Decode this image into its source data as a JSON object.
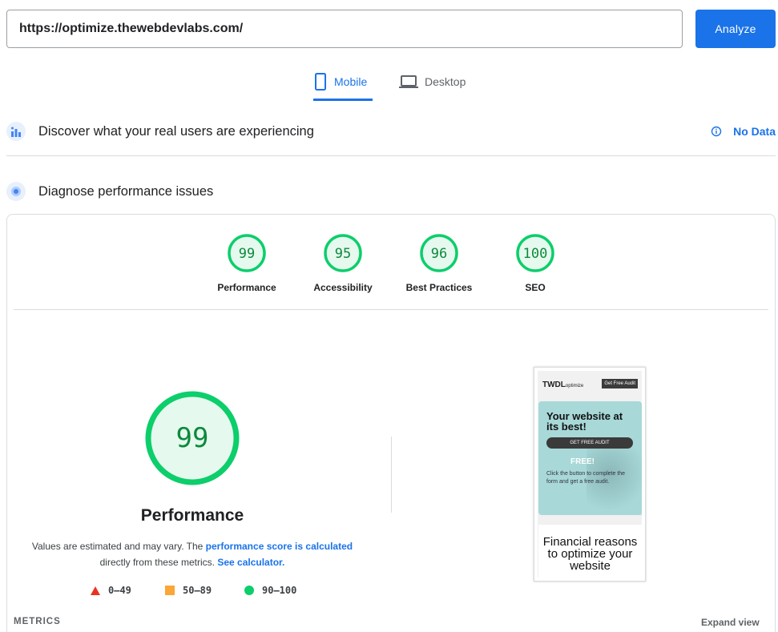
{
  "search": {
    "url_value": "https://optimize.thewebdevlabs.com/",
    "analyze_label": "Analyze"
  },
  "tabs": [
    {
      "label": "Mobile",
      "icon": "smartphone-icon",
      "active": true
    },
    {
      "label": "Desktop",
      "icon": "laptop-icon",
      "active": false
    }
  ],
  "crux": {
    "title": "Discover what your real users are experiencing",
    "icon": "users-chart-icon",
    "status_icon": "info-icon",
    "status": "No Data"
  },
  "diagnose": {
    "title": "Diagnose performance issues",
    "icon": "lighthouse-icon"
  },
  "categories": [
    {
      "score": 99,
      "label": "Performance"
    },
    {
      "score": 95,
      "label": "Accessibility"
    },
    {
      "score": 96,
      "label": "Best Practices"
    },
    {
      "score": 100,
      "label": "SEO"
    }
  ],
  "performance": {
    "score": 99,
    "title": "Performance",
    "desc_prefix": "Values are estimated and may vary. The ",
    "desc_link": "performance score is calculated",
    "desc_middle": "directly from these metrics. ",
    "desc_link2": "See calculator.",
    "legend": [
      {
        "range": "0–49",
        "shape": "triangle",
        "color": "#e8341f"
      },
      {
        "range": "50–89",
        "shape": "square",
        "color": "#fba637"
      },
      {
        "range": "90–100",
        "shape": "circle",
        "color": "#0cce6b"
      }
    ]
  },
  "thumbnail": {
    "brand": "TWDL",
    "brand_small": "optimize",
    "audit_btn": "Get Free Audit",
    "hero_title": "Your website at its best!",
    "hero_btn": "GET FREE AUDIT",
    "free": "FREE!",
    "body": "Click the button to complete the form and get a free audit.",
    "bottom_title": "Financial reasons to optimize your website"
  },
  "metrics": {
    "label": "METRICS",
    "expand": "Expand view"
  },
  "colors": {
    "accent": "#1a73e8",
    "pass": "#0cce6b",
    "pass_text": "#0c8a3c"
  }
}
